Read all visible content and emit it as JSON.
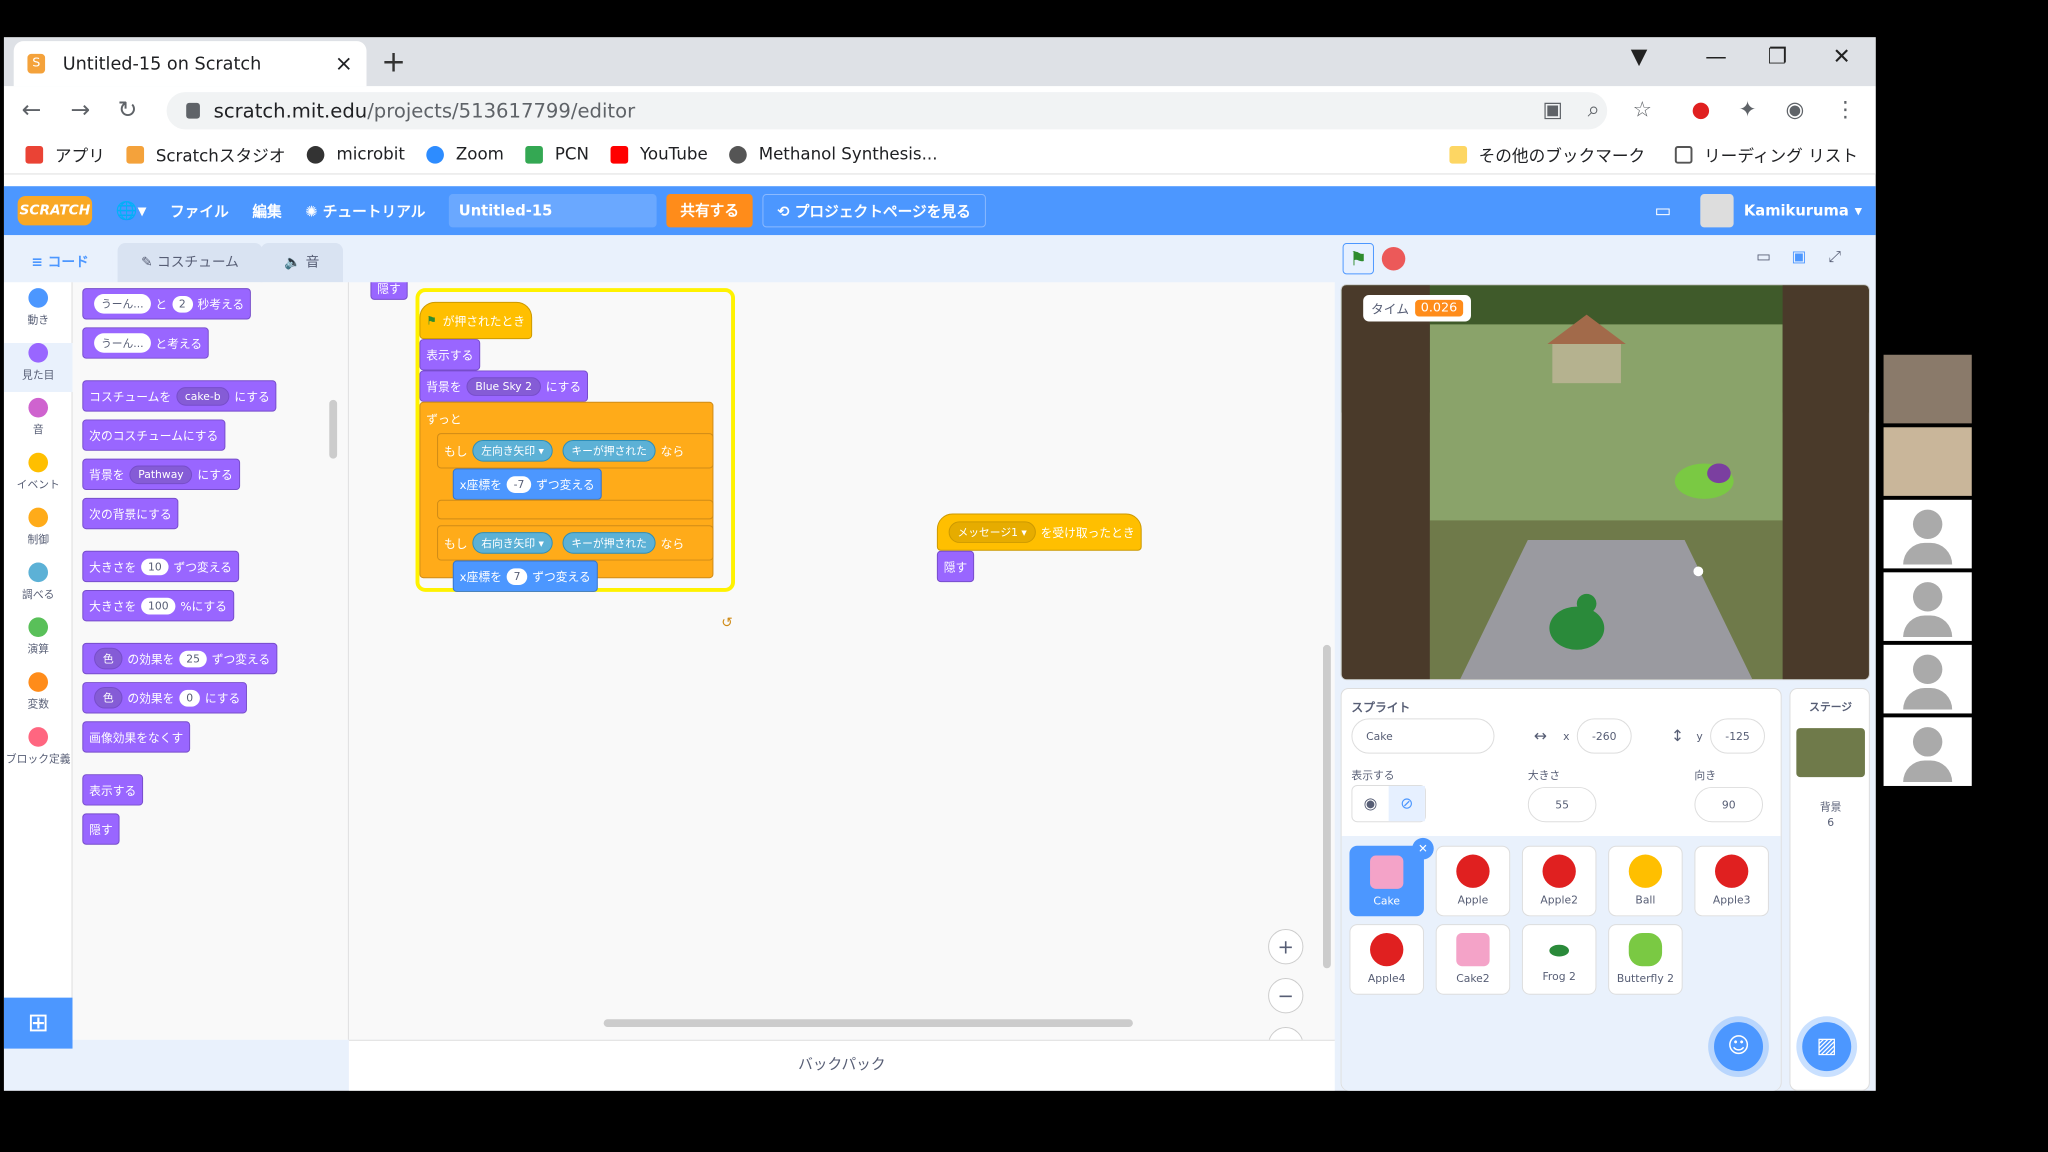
{
  "browser": {
    "tab_title": "Untitled-15 on Scratch",
    "url_host": "scratch.mit.edu",
    "url_path": "/projects/513617799/editor",
    "bookmarks": [
      "アプリ",
      "Scratchスタジオ",
      "microbit",
      "Zoom",
      "PCN",
      "YouTube",
      "Methanol Synthesis..."
    ],
    "bookmarks_right": [
      "その他のブックマーク",
      "リーディング リスト"
    ]
  },
  "menubar": {
    "logo": "SCRATCH",
    "file": "ファイル",
    "edit": "編集",
    "tutorial": "チュートリアル",
    "project_title": "Untitled-15",
    "share": "共有する",
    "see_project_page": "プロジェクトページを見る",
    "username": "Kamikuruma"
  },
  "tabs": {
    "code": "コード",
    "costumes": "コスチューム",
    "sounds": "音"
  },
  "categories": [
    {
      "label": "動き",
      "color": "#4c97ff"
    },
    {
      "label": "見た目",
      "color": "#9966ff"
    },
    {
      "label": "音",
      "color": "#cf63cf"
    },
    {
      "label": "イベント",
      "color": "#ffbf00"
    },
    {
      "label": "制御",
      "color": "#ffab19"
    },
    {
      "label": "調べる",
      "color": "#5cb1d6"
    },
    {
      "label": "演算",
      "color": "#59c059"
    },
    {
      "label": "変数",
      "color": "#ff8c1a"
    },
    {
      "label": "ブロック定義",
      "color": "#ff6680"
    }
  ],
  "palette": {
    "think_for": {
      "msg": "うーん...",
      "mid": "と",
      "secs": "2",
      "end": "秒考える"
    },
    "think": {
      "msg": "うーん...",
      "end": "と考える"
    },
    "switch_costume": {
      "pre": "コスチュームを",
      "val": "cake-b",
      "end": "にする"
    },
    "next_costume": "次のコスチュームにする",
    "switch_backdrop": {
      "pre": "背景を",
      "val": "Pathway",
      "end": "にする"
    },
    "next_backdrop": "次の背景にする",
    "change_size": {
      "pre": "大きさを",
      "val": "10",
      "end": "ずつ変える"
    },
    "set_size": {
      "pre": "大きさを",
      "val": "100",
      "end": "%にする"
    },
    "change_effect": {
      "dd": "色",
      "mid": "の効果を",
      "val": "25",
      "end": "ずつ変える"
    },
    "set_effect": {
      "dd": "色",
      "mid": "の効果を",
      "val": "0",
      "end": "にする"
    },
    "clear_effects": "画像効果をなくす",
    "show": "表示する",
    "hide": "隠す"
  },
  "script": {
    "partial_top": "隠す",
    "flag_hat": "が押されたとき",
    "show": "表示する",
    "backdrop": {
      "pre": "背景を",
      "val": "Blue Sky 2",
      "end": "にする"
    },
    "forever": "ずっと",
    "if1": {
      "if": "もし",
      "key": "左向き矢印",
      "pressed": "キーが押された",
      "then": "なら"
    },
    "move1": {
      "pre": "x座標を",
      "val": "-7",
      "end": "ずつ変える"
    },
    "if2": {
      "if": "もし",
      "key": "右向き矢印",
      "pressed": "キーが押された",
      "then": "なら"
    },
    "move2": {
      "pre": "x座標を",
      "val": "7",
      "end": "ずつ変える"
    },
    "receive_hat": {
      "msg": "メッセージ1",
      "end": "を受け取ったとき"
    },
    "hide": "隠す"
  },
  "backpack": "バックパック",
  "stage": {
    "timer_label": "タイム",
    "timer_value": "0.026"
  },
  "sprite_info": {
    "sprite_label": "スプライト",
    "name": "Cake",
    "x_label": "x",
    "x": "-260",
    "y_label": "y",
    "y": "-125",
    "show_label": "表示する",
    "size_label": "大きさ",
    "size": "55",
    "direction_label": "向き",
    "direction": "90"
  },
  "sprites": [
    {
      "name": "Cake",
      "color": "#f4a3c8"
    },
    {
      "name": "Apple",
      "color": "#e02020"
    },
    {
      "name": "Apple2",
      "color": "#e02020"
    },
    {
      "name": "Ball",
      "color": "#ffbf00"
    },
    {
      "name": "Apple3",
      "color": "#e02020"
    },
    {
      "name": "Apple4",
      "color": "#e02020"
    },
    {
      "name": "Cake2",
      "color": "#f4a3c8"
    },
    {
      "name": "Frog 2",
      "color": "#2a8a3a"
    },
    {
      "name": "Butterfly 2",
      "color": "#7ac943"
    }
  ],
  "stage_pane": {
    "label": "ステージ",
    "backdrop_label": "背景",
    "backdrop_count": "6"
  }
}
